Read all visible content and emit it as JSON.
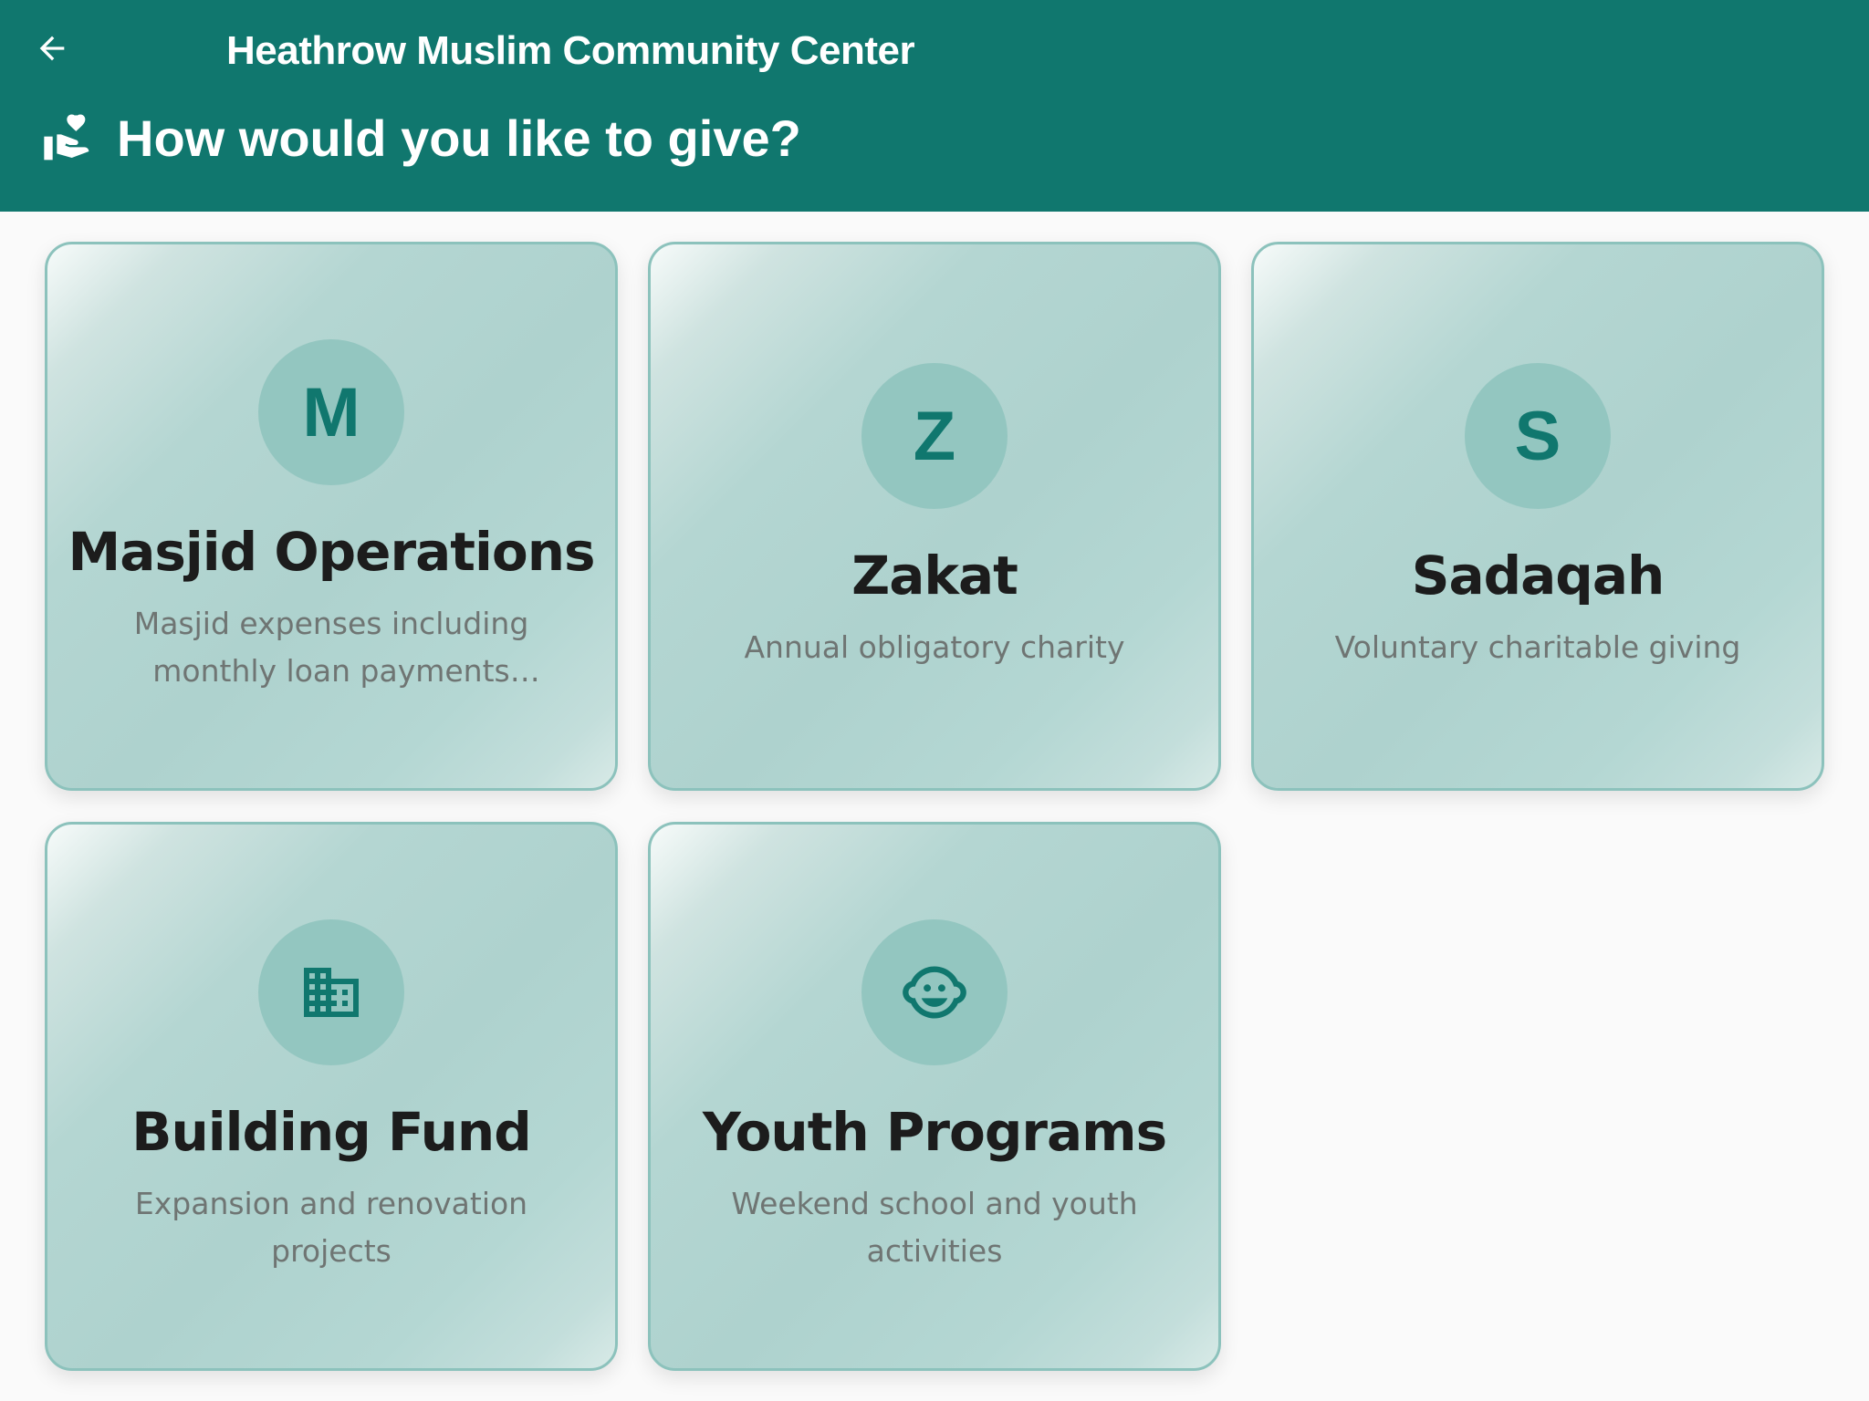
{
  "header": {
    "title": "Heathrow Muslim Community Center",
    "subtitle": "How would you like to give?",
    "back_icon": "arrow-left-icon",
    "subtitle_icon": "hand-heart-icon",
    "background_color": "#10776e"
  },
  "cards": [
    {
      "icon_type": "letter",
      "letter": "M",
      "title": "Masjid Operations",
      "description": "Masjid expenses including monthly loan payments toward…"
    },
    {
      "icon_type": "letter",
      "letter": "Z",
      "title": "Zakat",
      "description": "Annual obligatory charity"
    },
    {
      "icon_type": "letter",
      "letter": "S",
      "title": "Sadaqah",
      "description": "Voluntary charitable giving"
    },
    {
      "icon_type": "icon",
      "icon": "building-icon",
      "title": "Building Fund",
      "description": "Expansion and renovation projects"
    },
    {
      "icon_type": "icon",
      "icon": "child-face-icon",
      "title": "Youth Programs",
      "description": "Weekend school and youth activities"
    }
  ],
  "colors": {
    "accent": "#10776e",
    "card_border": "#8cc2bc",
    "avatar_bg": "#93c6c0",
    "title_text": "#1c1c1c",
    "desc_text": "#6f7573"
  }
}
